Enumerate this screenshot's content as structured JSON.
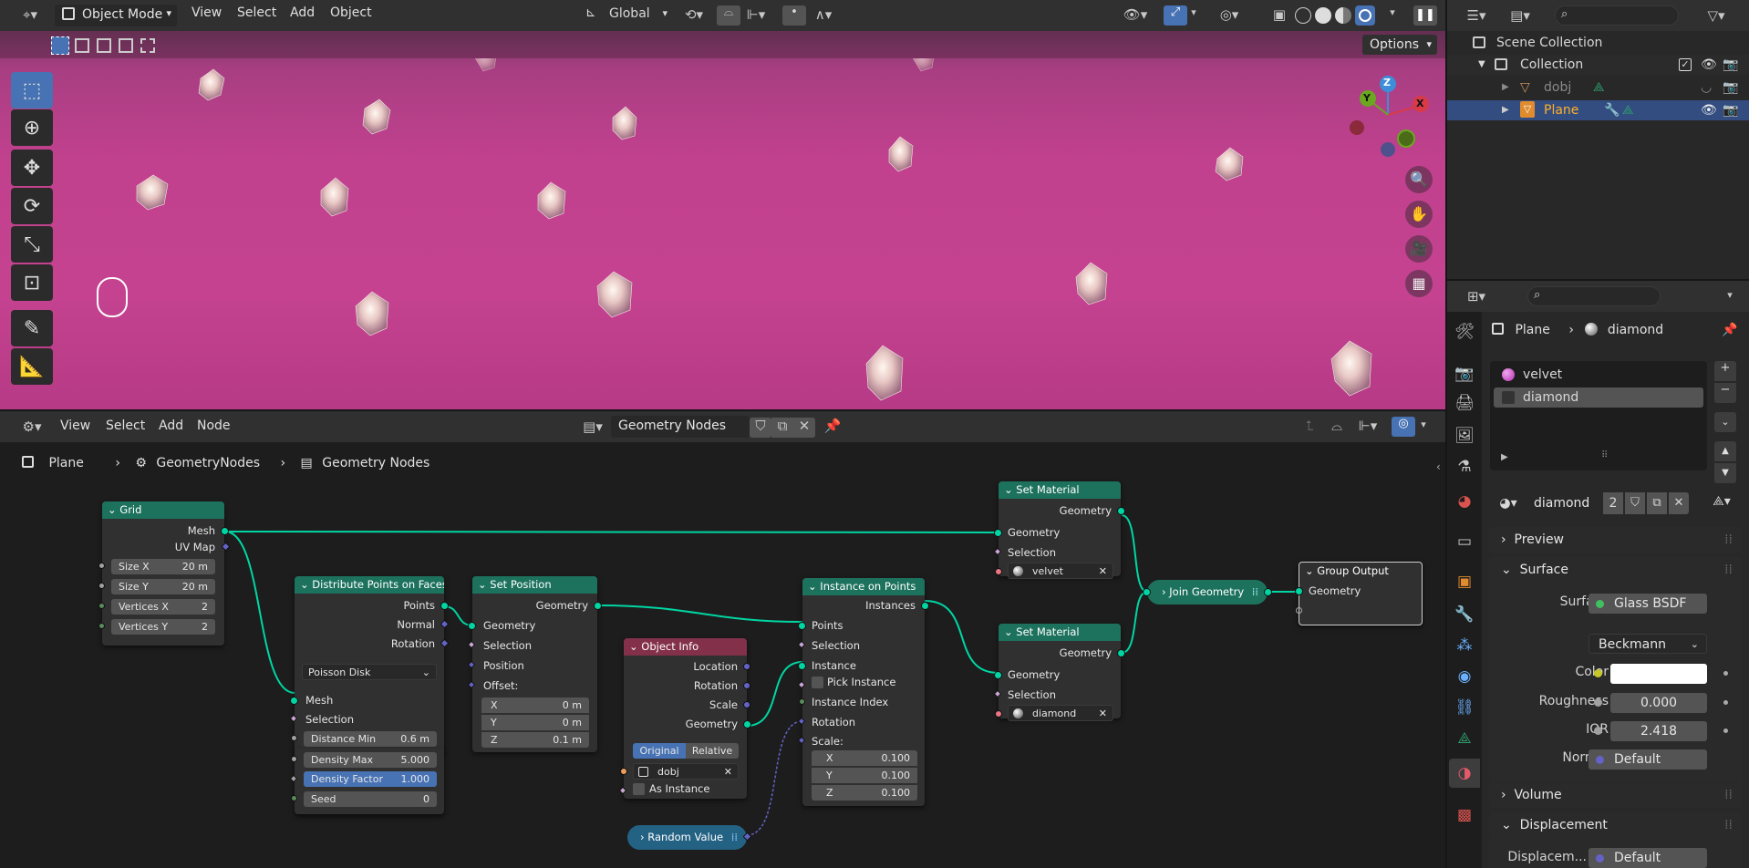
{
  "viewport": {
    "mode": "Object Mode",
    "menus": [
      "View",
      "Select",
      "Add",
      "Object"
    ],
    "transform_orientation": "Global",
    "options_label": "Options",
    "gizmo_axes": {
      "x": "X",
      "y": "Y",
      "z": "Z"
    }
  },
  "node_editor": {
    "menus": [
      "View",
      "Select",
      "Add",
      "Node"
    ],
    "tree_name": "Geometry Nodes",
    "breadcrumb": [
      "Plane",
      "GeometryNodes",
      "Geometry Nodes"
    ],
    "nodes": {
      "grid": {
        "title": "Grid",
        "out_mesh": "Mesh",
        "out_uv": "UV Map",
        "size_x_label": "Size X",
        "size_x": "20 m",
        "size_y_label": "Size Y",
        "size_y": "20 m",
        "verts_x_label": "Vertices X",
        "verts_x": "2",
        "verts_y_label": "Vertices Y",
        "verts_y": "2"
      },
      "distribute": {
        "title": "Distribute Points on Faces",
        "out_points": "Points",
        "out_normal": "Normal",
        "out_rotation": "Rotation",
        "method": "Poisson Disk",
        "in_mesh": "Mesh",
        "in_selection": "Selection",
        "dist_min_label": "Distance Min",
        "dist_min": "0.6 m",
        "density_max_label": "Density Max",
        "density_max": "5.000",
        "density_factor_label": "Density Factor",
        "density_factor": "1.000",
        "seed_label": "Seed",
        "seed": "0"
      },
      "set_position": {
        "title": "Set Position",
        "out_geometry": "Geometry",
        "in_geometry": "Geometry",
        "in_selection": "Selection",
        "in_position": "Position",
        "in_offset": "Offset:",
        "x_label": "X",
        "x": "0 m",
        "y_label": "Y",
        "y": "0 m",
        "z_label": "Z",
        "z": "0.1 m"
      },
      "object_info": {
        "title": "Object Info",
        "out_location": "Location",
        "out_rotation": "Rotation",
        "out_scale": "Scale",
        "out_geometry": "Geometry",
        "btn_original": "Original",
        "btn_relative": "Relative",
        "object": "dobj",
        "as_instance": "As Instance"
      },
      "instance": {
        "title": "Instance on Points",
        "out_instances": "Instances",
        "in_points": "Points",
        "in_selection": "Selection",
        "in_instance": "Instance",
        "pick_instance": "Pick Instance",
        "instance_index": "Instance Index",
        "in_rotation": "Rotation",
        "in_scale": "Scale:",
        "x_label": "X",
        "x": "0.100",
        "y_label": "Y",
        "y": "0.100",
        "z_label": "Z",
        "z": "0.100"
      },
      "set_mat1": {
        "title": "Set Material",
        "out_geometry": "Geometry",
        "in_geometry": "Geometry",
        "in_selection": "Selection",
        "material": "velvet"
      },
      "set_mat2": {
        "title": "Set Material",
        "out_geometry": "Geometry",
        "in_geometry": "Geometry",
        "in_selection": "Selection",
        "material": "diamond"
      },
      "join": {
        "title": "Join Geometry"
      },
      "group_output": {
        "title": "Group Output",
        "in_geometry": "Geometry"
      },
      "random": {
        "title": "Random Value"
      }
    }
  },
  "outliner": {
    "scene_collection": "Scene Collection",
    "collection": "Collection",
    "items": [
      "dobj",
      "Plane"
    ]
  },
  "properties": {
    "breadcrumb_object": "Plane",
    "breadcrumb_material": "diamond",
    "material_slots": [
      "velvet",
      "diamond"
    ],
    "material_name": "diamond",
    "users": "2",
    "panels": {
      "preview": "Preview",
      "surface": "Surface",
      "volume": "Volume",
      "displacement": "Displacement"
    },
    "surface_label": "Surface",
    "surface_value": "Glass BSDF",
    "distribution": "Beckmann",
    "color_label": "Color",
    "color_value": "#ffffff",
    "roughness_label": "Roughness",
    "roughness": "0.000",
    "ior_label": "IOR",
    "ior": "2.418",
    "normal_label": "Normal",
    "normal": "Default",
    "displacement_label": "Displacem...",
    "displacement": "Default"
  },
  "colors": {
    "accent": "#4772b3",
    "geometry_header": "#1d725e",
    "input_header": "#83314a",
    "geometry_socket": "#00d6a3",
    "viewport_bg": "#c2418f"
  }
}
